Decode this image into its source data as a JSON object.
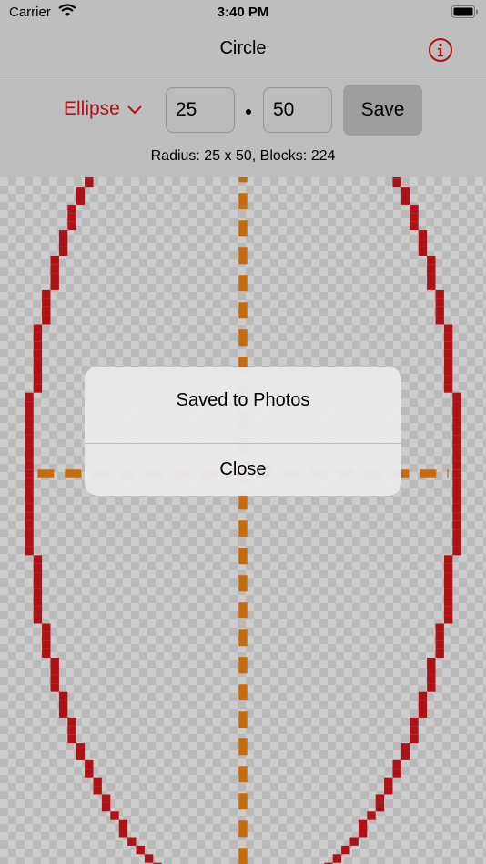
{
  "status_bar": {
    "carrier": "Carrier",
    "time": "3:40 PM",
    "icons": [
      "wifi-icon",
      "battery-icon"
    ]
  },
  "nav": {
    "title": "Circle",
    "info_icon": "info-icon"
  },
  "controls": {
    "shape": "Ellipse",
    "shape_icon": "chevron-down-icon",
    "radius_x": "25",
    "radius_y": "50",
    "separator": "•",
    "save_label": "Save",
    "radius_text": "Radius: 25 x 50, Blocks: 224"
  },
  "canvas": {
    "shape_color": "#c8151a",
    "axis_color": "#e07b10",
    "background": "checkerboard"
  },
  "alert": {
    "message": "Saved to Photos",
    "close_label": "Close"
  }
}
